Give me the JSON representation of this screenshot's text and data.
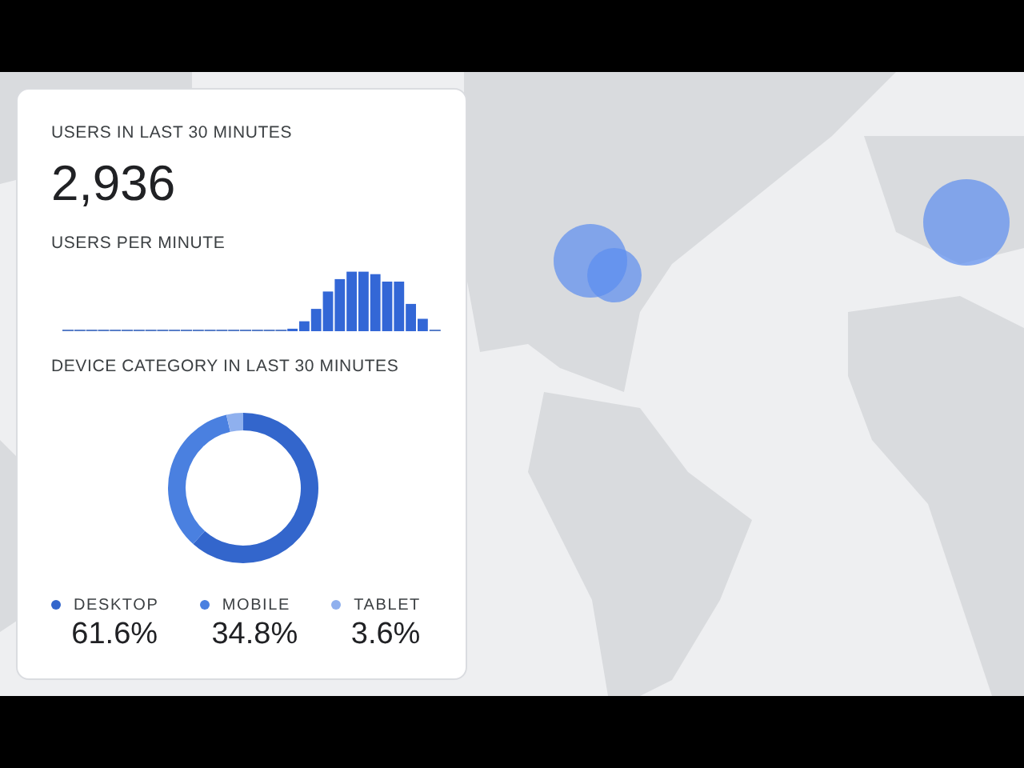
{
  "realtime_card": {
    "users_title": "USERS IN LAST 30 MINUTES",
    "users_count": "2,936",
    "per_minute_title": "USERS PER MINUTE",
    "device_title": "DEVICE CATEGORY IN LAST 30 MINUTES",
    "chart_data": {
      "type": "donut",
      "categories": [
        "DESKTOP",
        "MOBILE",
        "TABLET"
      ],
      "series": [
        {
          "values": [
            61.6,
            34.8,
            3.6
          ]
        }
      ]
    },
    "legend": [
      {
        "value": "61.6%",
        "color": "#3366cc"
      },
      {
        "value": "34.8%",
        "color": "#4a80e0"
      },
      {
        "value": "3.6%",
        "color": "#8fb0ee"
      }
    ]
  }
}
